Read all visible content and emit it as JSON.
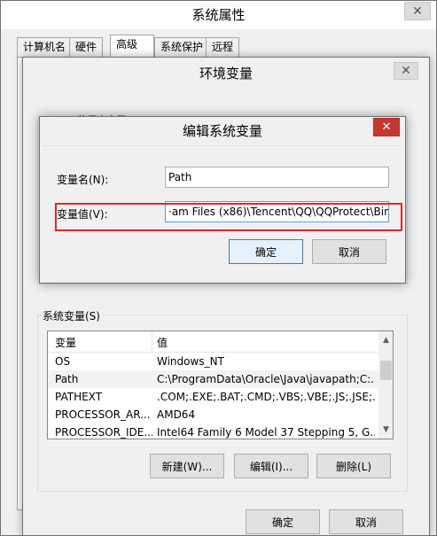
{
  "system_properties": {
    "title": "系统属性",
    "close_glyph": "✕",
    "tabs": [
      {
        "label": "计算机名"
      },
      {
        "label": "硬件"
      },
      {
        "label": "高级"
      },
      {
        "label": "系统保护"
      },
      {
        "label": "远程"
      }
    ],
    "active_tab": "高级",
    "ok_label": "确定",
    "cancel_label": "取消"
  },
  "env_window": {
    "title": "环境变量",
    "close_glyph": "✕",
    "user_vars_label": "A... 的用户变量(U)",
    "system_vars_label": "系统变量(S)",
    "system_table": {
      "columns": [
        "变量",
        "值"
      ],
      "rows": [
        {
          "name": "OS",
          "value": "Windows_NT"
        },
        {
          "name": "Path",
          "value": "C:\\ProgramData\\Oracle\\Java\\javapath;C:..."
        },
        {
          "name": "PATHEXT",
          "value": ".COM;.EXE;.BAT;.CMD;.VBS;.VBE;.JS;.JSE;..."
        },
        {
          "name": "PROCESSOR_AR...",
          "value": "AMD64"
        },
        {
          "name": "PROCESSOR_IDE...",
          "value": "Intel64 Family 6 Model 37 Stepping 5, G..."
        }
      ],
      "selected_row": "Path",
      "scroll_up_glyph": "▲",
      "scroll_down_glyph": "▼"
    },
    "buttons": {
      "new_label": "新建(W)...",
      "edit_label": "编辑(I)...",
      "delete_label": "删除(L)"
    }
  },
  "edit_dialog": {
    "title": "编辑系统变量",
    "close_glyph": "✕",
    "name_label": "变量名(N):",
    "name_value": "Path",
    "value_label": "变量值(V):",
    "value_value": "·am Files (x86)\\Tencent\\QQ\\QQProtect\\Bin",
    "ok_label": "确定",
    "cancel_label": "取消",
    "highlight_color": "#e0262c"
  },
  "colors": {
    "close_button_active": "#c7372f",
    "default_button_border": "#3c7fb1"
  }
}
